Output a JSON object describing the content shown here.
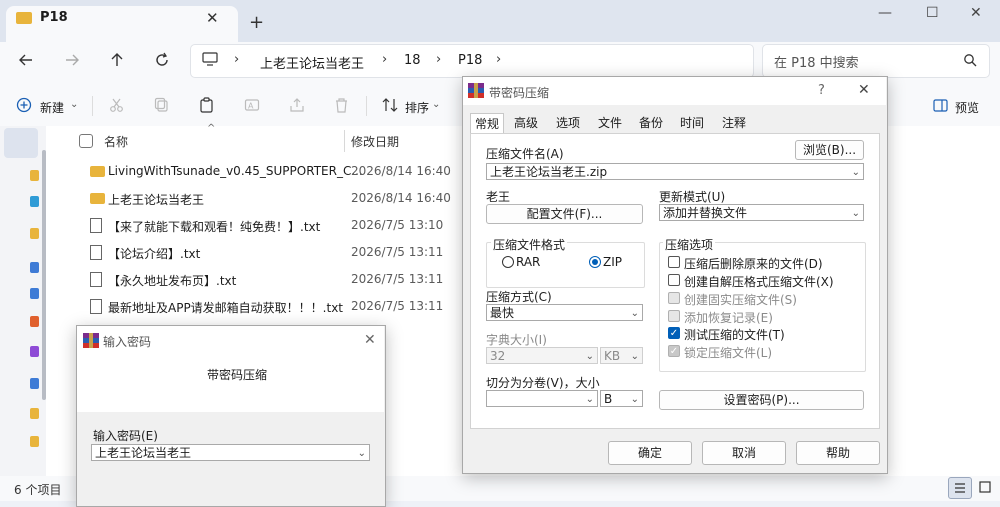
{
  "explorer": {
    "tab_title": "P18",
    "breadcrumb": [
      "上老王论坛当老王",
      "18",
      "P18"
    ],
    "search_placeholder": "在 P18 中搜索",
    "cmd": {
      "new_label": "新建",
      "sort_label": "排序",
      "preview_label": "预览"
    },
    "columns": {
      "name": "名称",
      "modified": "修改日期"
    },
    "files": [
      {
        "name": "LivingWithTsunade_v0.45_SUPPORTER_C...",
        "date": "2026/8/14 16:40",
        "type": "folder"
      },
      {
        "name": "上老王论坛当老王",
        "date": "2026/8/14 16:40",
        "type": "folder"
      },
      {
        "name": "【来了就能下载和观看！纯免费！】.txt",
        "date": "2026/7/5 13:10",
        "type": "txt"
      },
      {
        "name": "【论坛介绍】.txt",
        "date": "2026/7/5 13:11",
        "type": "txt"
      },
      {
        "name": "【永久地址发布页】.txt",
        "date": "2026/7/5 13:11",
        "type": "txt"
      },
      {
        "name": "最新地址及APP请发邮箱自动获取！！！.txt",
        "date": "2026/7/5 13:11",
        "type": "txt"
      }
    ],
    "status_count": "6 个项目"
  },
  "pw_dialog": {
    "title": "输入密码",
    "subtitle": "带密码压缩",
    "field_label": "输入密码(E)",
    "field_value": "上老王论坛当老王"
  },
  "zip_dialog": {
    "title": "带密码压缩",
    "help": "?",
    "tabs": [
      "常规",
      "高级",
      "选项",
      "文件",
      "备份",
      "时间",
      "注释"
    ],
    "archive_name_label": "压缩文件名(A)",
    "browse_button": "浏览(B)...",
    "archive_name_value": "上老王论坛当老王.zip",
    "profile_label": "老王",
    "profile_button": "配置文件(F)...",
    "update_mode_label": "更新模式(U)",
    "update_mode_value": "添加并替换文件",
    "format_group": "压缩文件格式",
    "format_rar": "RAR",
    "format_zip": "ZIP",
    "options_group": "压缩选项",
    "options": [
      {
        "label": "压缩后删除原来的文件(D)",
        "checked": false,
        "disabled": false
      },
      {
        "label": "创建自解压格式压缩文件(X)",
        "checked": false,
        "disabled": false
      },
      {
        "label": "创建固实压缩文件(S)",
        "checked": false,
        "disabled": true
      },
      {
        "label": "添加恢复记录(E)",
        "checked": false,
        "disabled": true
      },
      {
        "label": "测试压缩的文件(T)",
        "checked": true,
        "disabled": false
      },
      {
        "label": "锁定压缩文件(L)",
        "checked": true,
        "disabled": true
      }
    ],
    "method_label": "压缩方式(C)",
    "method_value": "最快",
    "dict_label": "字典大小(I)",
    "dict_value": "32",
    "dict_unit": "KB",
    "split_label": "切分为分卷(V)，大小",
    "split_value": "",
    "split_unit": "B",
    "set_password_button": "设置密码(P)...",
    "ok_button": "确定",
    "cancel_button": "取消",
    "help_button": "帮助"
  }
}
